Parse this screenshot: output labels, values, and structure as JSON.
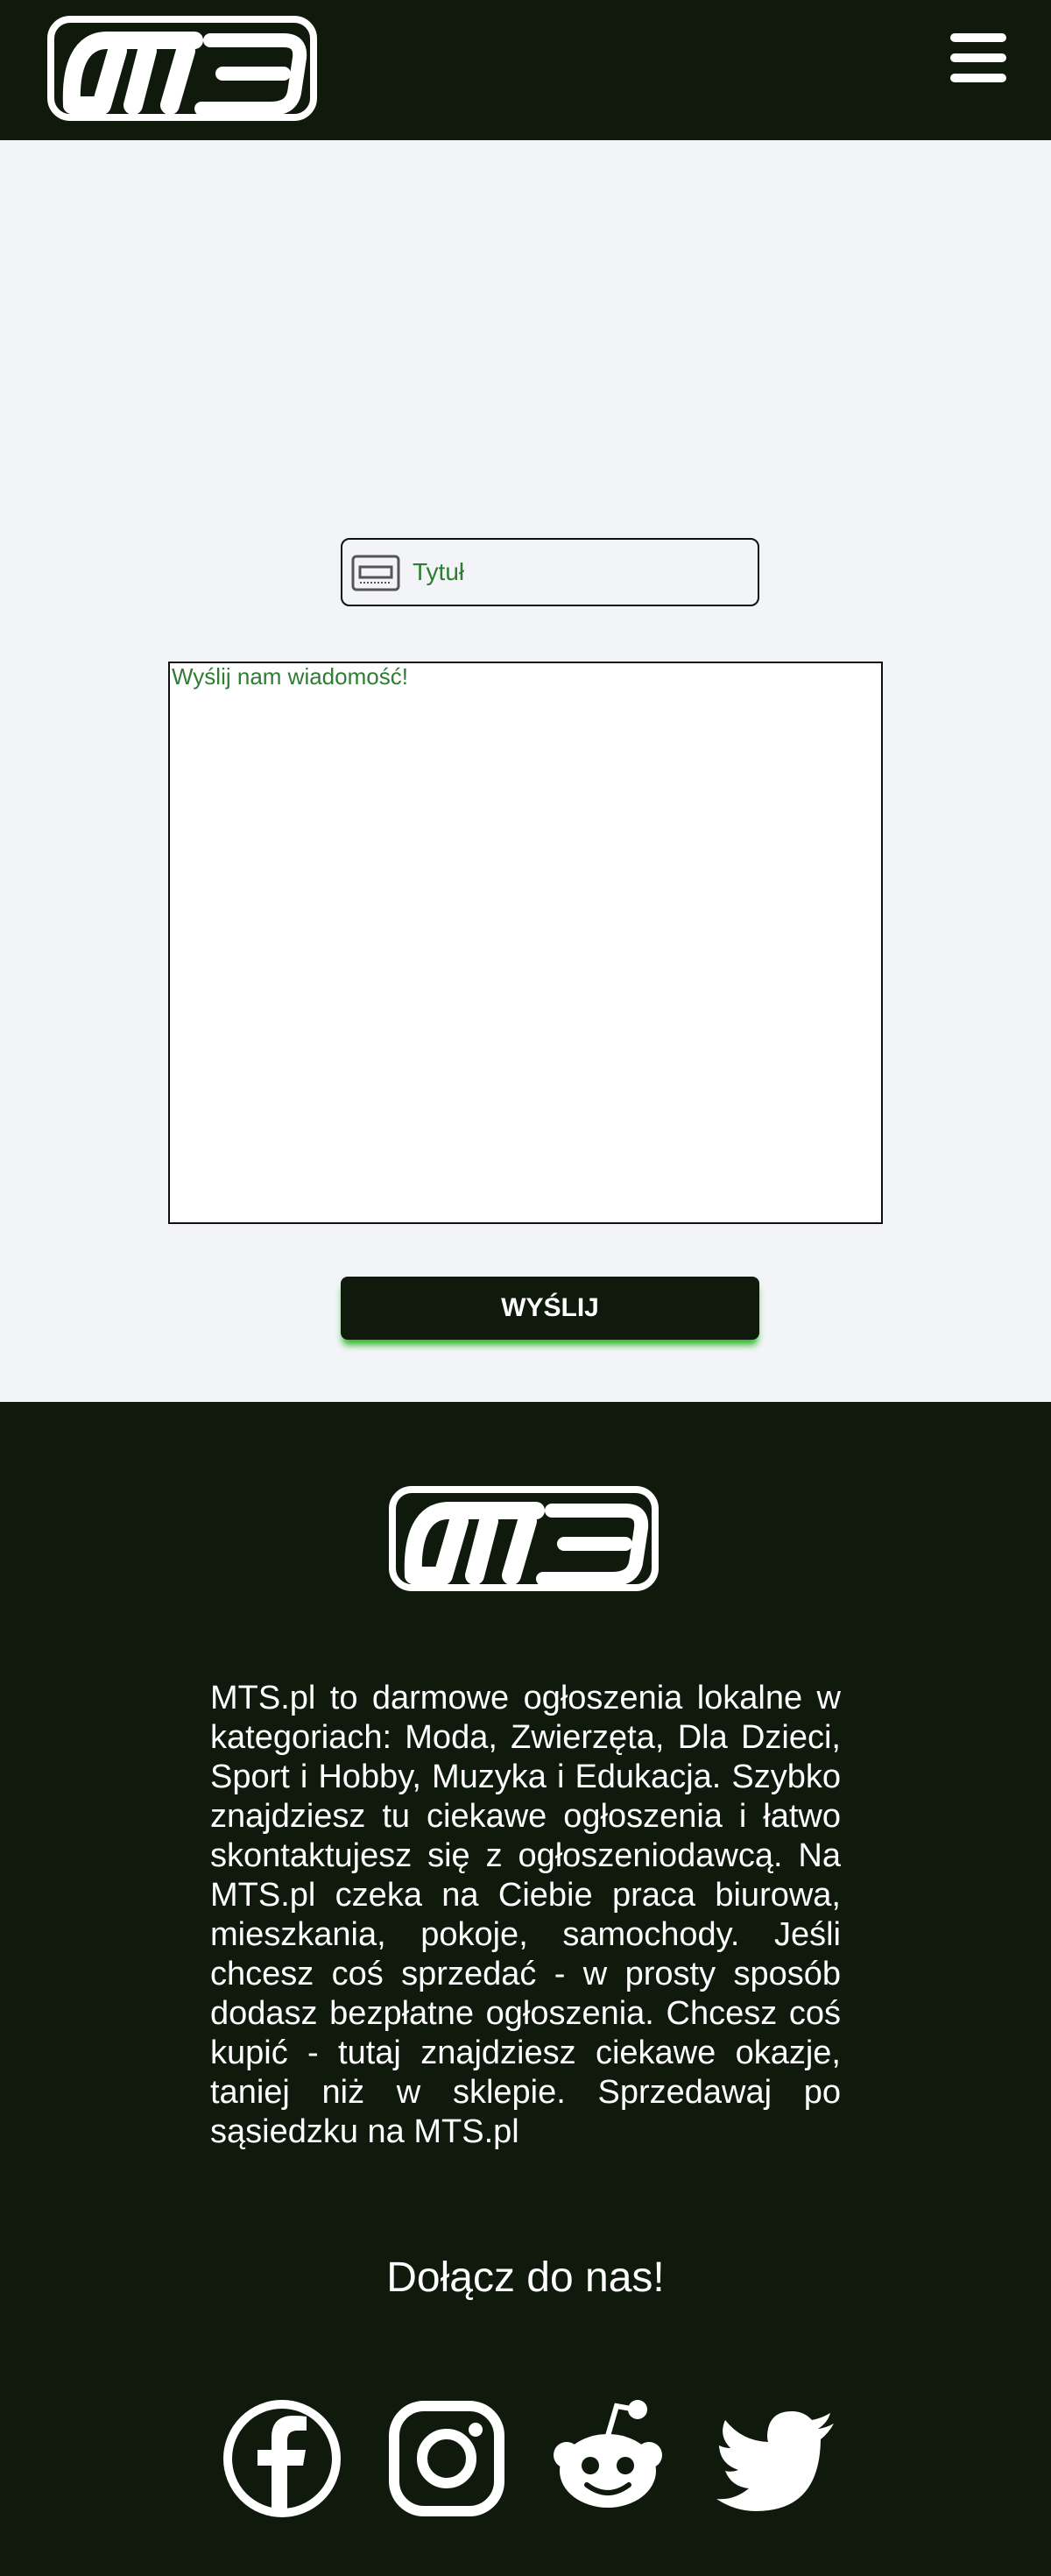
{
  "header": {
    "logo_text": "MTS",
    "menu_icon": "hamburger-menu-icon"
  },
  "contact_form": {
    "title_placeholder": "Tytuł",
    "title_icon": "card-icon",
    "message_placeholder": "Wyślij nam wiadomość!",
    "submit_label": "WYŚLIJ"
  },
  "footer": {
    "logo_text": "MTS",
    "about": "MTS.pl to darmowe ogłoszenia lokalne w kategoriach: Moda, Zwierzęta, Dla Dzieci, Sport i Hobby, Muzyka i Edukacja. Szybko znajdziesz tu ciekawe ogłoszenia i łatwo skontaktujesz się z ogłoszeniodawcą. Na MTS.pl czeka na Ciebie praca biurowa, mieszkania, pokoje, samochody. Jeśli chcesz coś sprzedać - w prosty sposób dodasz bezpłatne ogłoszenia. Chcesz coś kupić - tutaj znajdziesz ciekawe okazje, taniej niż w sklepie. Sprzedawaj po sąsiedzku na MTS.pl",
    "join_heading": "Dołącz do nas!",
    "social_icons": [
      "facebook-icon",
      "instagram-icon",
      "reddit-icon",
      "twitter-icon"
    ]
  },
  "colors": {
    "header_background": "#0f190c",
    "page_background": "#f2f4f7",
    "placeholder_text": "#2f7d32",
    "button_glow": "#2fb82a"
  }
}
